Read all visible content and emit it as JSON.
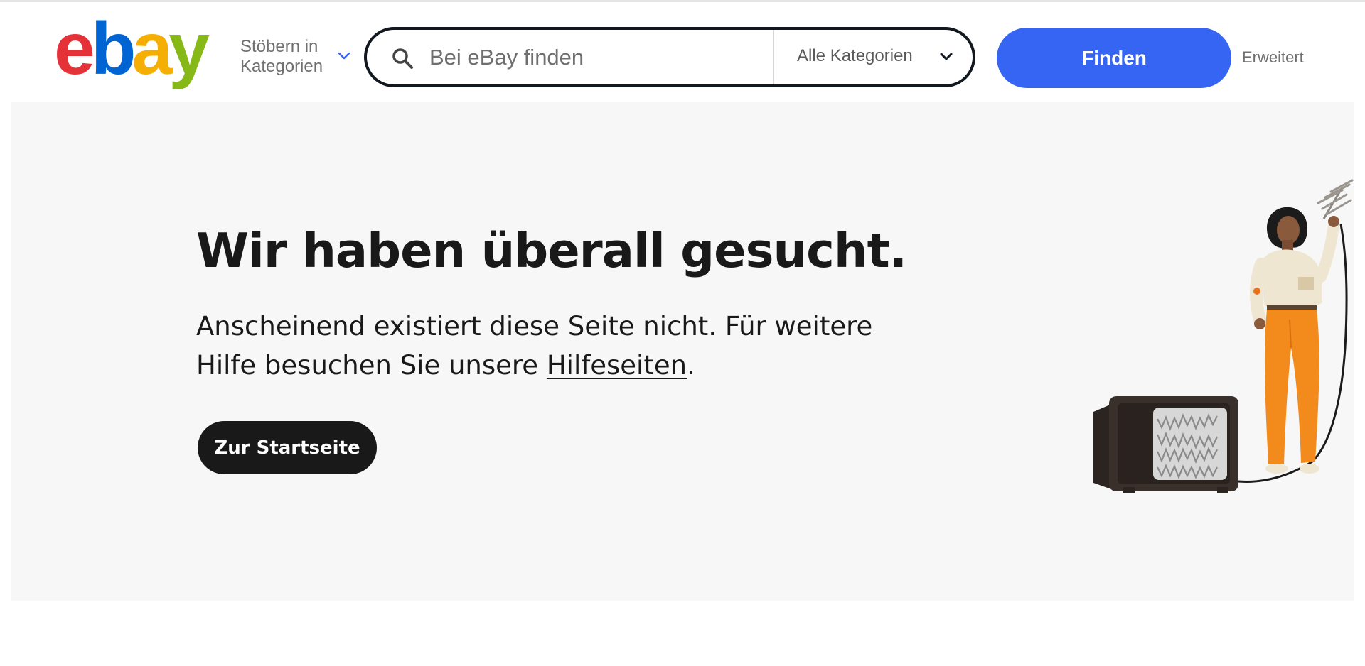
{
  "header": {
    "logo_text": "ebay",
    "browse_label": "Stöbern in Kategorien",
    "search": {
      "placeholder": "Bei eBay finden",
      "value": "",
      "category": "Alle Kategorien"
    },
    "find_label": "Finden",
    "advanced_label": "Erweitert"
  },
  "main": {
    "headline": "Wir haben überall gesucht.",
    "message_pre": "Anscheinend existiert diese Seite nicht. Für weitere Hilfe besuchen Sie unsere ",
    "help_link": "Hilfeseiten",
    "message_post": ".",
    "home_button": "Zur Startseite"
  },
  "icons": {
    "search": "search-icon",
    "browse_chevron": "chevron-down-icon",
    "category_chevron": "chevron-down-icon"
  },
  "colors": {
    "logo_e": "#e53238",
    "logo_b": "#0064d2",
    "logo_a": "#f5af02",
    "logo_y": "#86b817",
    "find_button": "#3665f3",
    "home_button": "#191919",
    "hero_background": "#f7f7f7"
  }
}
